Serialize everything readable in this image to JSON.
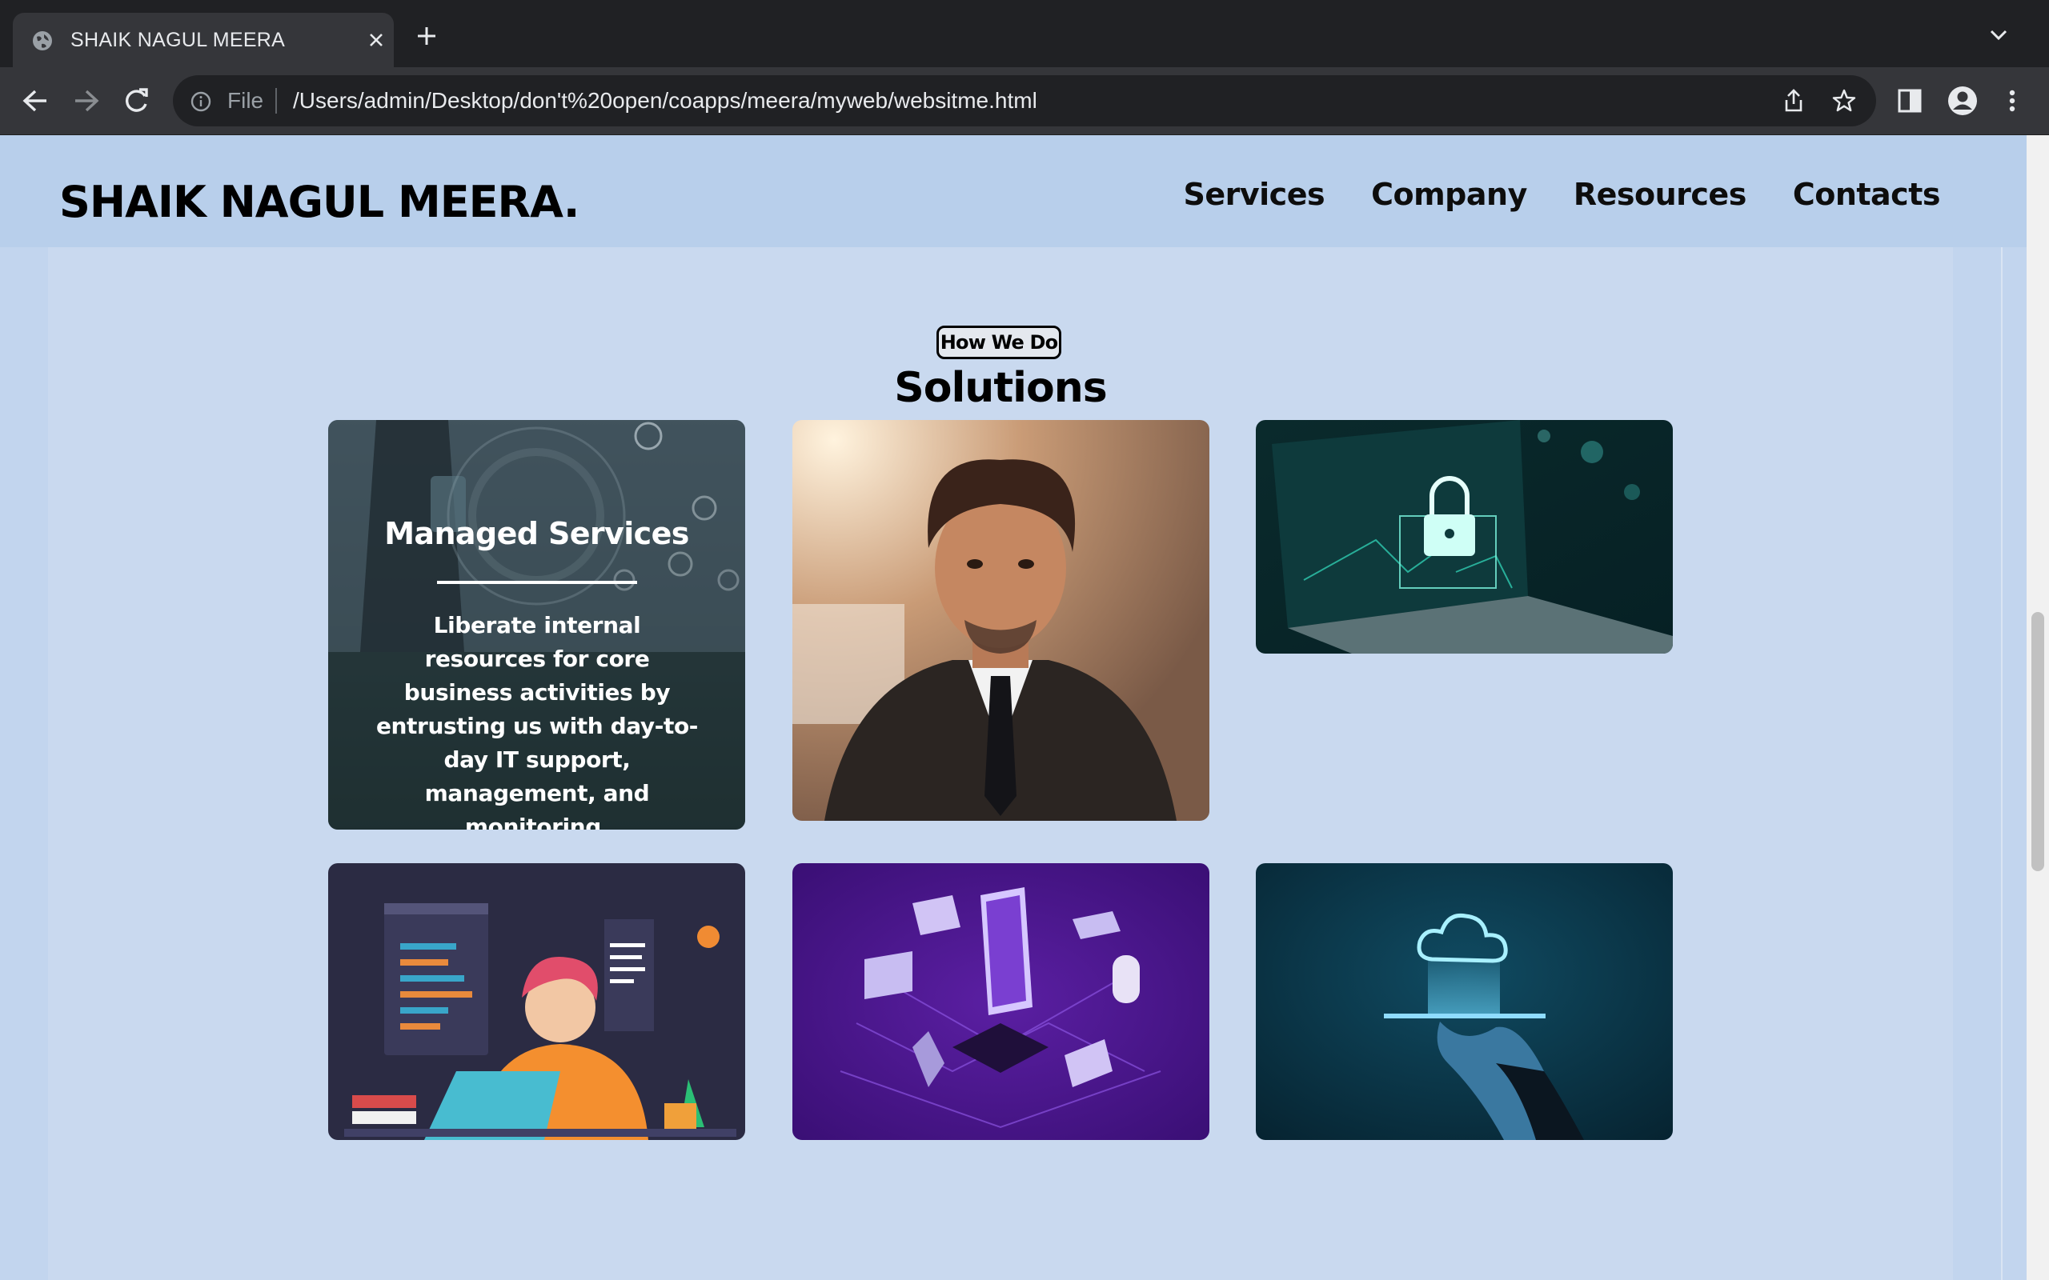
{
  "browser": {
    "tab_title": "SHAIK NAGUL MEERA",
    "url_scheme": "File",
    "url": "/Users/admin/Desktop/don't%20open/coapps/meera/myweb/websitme.html"
  },
  "site": {
    "brand": "SHAIK NAGUL MEERA.",
    "nav": [
      "Services",
      "Company",
      "Resources",
      "Contacts"
    ]
  },
  "solutions": {
    "eyebrow": "How We Do",
    "title": "Solutions",
    "cards": [
      {
        "image": "business-tech-icons-photo",
        "heading": "Managed Services",
        "text": "Liberate internal resources for core business activities by entrusting us with day-to-day IT support, management, and monitoring."
      },
      {
        "image": "portrait-photo"
      },
      {
        "image": "laptop-padlock-photo"
      },
      {
        "image": "web-developer-illustration"
      },
      {
        "image": "isometric-iot-illustration"
      },
      {
        "image": "cloud-on-hand-photo"
      }
    ]
  },
  "colors": {
    "header_bg": "#b8cfeb",
    "page_bg": "#c9d9ef",
    "chrome_dark": "#202124",
    "chrome_toolbar": "#35363a"
  }
}
